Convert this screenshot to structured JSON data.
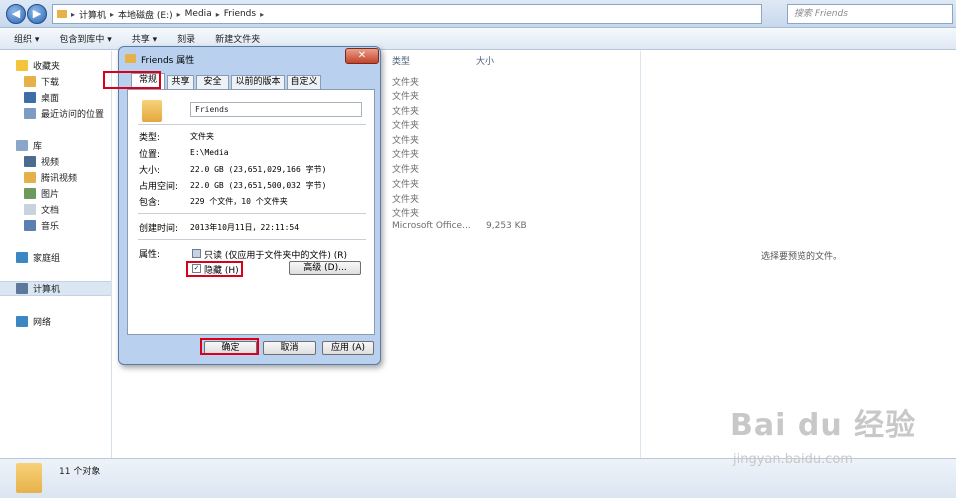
{
  "address_bar": {
    "crumbs": [
      "计算机",
      "本地磁盘 (E:)",
      "Media",
      "Friends"
    ],
    "search_placeholder": "搜索 Friends"
  },
  "toolbar": {
    "items": [
      "组织 ▾",
      "包含到库中 ▾",
      "共享 ▾",
      "刻录",
      "新建文件夹"
    ]
  },
  "nav": {
    "favorites": "收藏夹",
    "downloads": "下载",
    "desktop": "桌面",
    "recent": "最近访问的位置",
    "libraries": "库",
    "videos": "视频",
    "tencent_video": "腾讯视频",
    "pictures": "图片",
    "documents": "文档",
    "music": "音乐",
    "homegroup": "家庭组",
    "computer": "计算机",
    "network": "网络"
  },
  "columns": {
    "type": "类型",
    "size": "大小"
  },
  "rows": [
    {
      "type": "文件夹",
      "size": ""
    },
    {
      "type": "文件夹",
      "size": ""
    },
    {
      "type": "文件夹",
      "size": ""
    },
    {
      "type": "文件夹",
      "size": ""
    },
    {
      "type": "文件夹",
      "size": ""
    },
    {
      "type": "文件夹",
      "size": ""
    },
    {
      "type": "文件夹",
      "size": ""
    },
    {
      "type": "文件夹",
      "size": ""
    },
    {
      "type": "文件夹",
      "size": ""
    },
    {
      "type": "文件夹",
      "size": ""
    },
    {
      "type": "Microsoft Office...",
      "size": "9,253 KB"
    }
  ],
  "preview_text": "选择要预览的文件。",
  "status": "11 个对象",
  "dialog": {
    "title": "Friends 属性",
    "close": "✕",
    "tabs": [
      "常规",
      "共享",
      "安全",
      "以前的版本",
      "自定义"
    ],
    "name": "Friends",
    "fields": [
      {
        "label": "类型:",
        "value": "文件夹"
      },
      {
        "label": "位置:",
        "value": "E:\\Media"
      },
      {
        "label": "大小:",
        "value": "22.0 GB (23,651,029,166 字节)"
      },
      {
        "label": "占用空间:",
        "value": "22.0 GB (23,651,500,032 字节)"
      },
      {
        "label": "包含:",
        "value": "229 个文件，10 个文件夹"
      }
    ],
    "created_label": "创建时间:",
    "created_value": "2013年10月11日，22:11:54",
    "attributes_label": "属性:",
    "readonly_label": "只读 (仅应用于文件夹中的文件) (R)",
    "hidden_label": "隐藏 (H)",
    "hidden_checked": "✓",
    "advanced_label": "高级 (D)...",
    "ok_label": "确定",
    "cancel_label": "取消",
    "apply_label": "应用 (A)"
  },
  "watermark": {
    "main": "Bai du 经验",
    "sub": "jingyan.baidu.com"
  }
}
